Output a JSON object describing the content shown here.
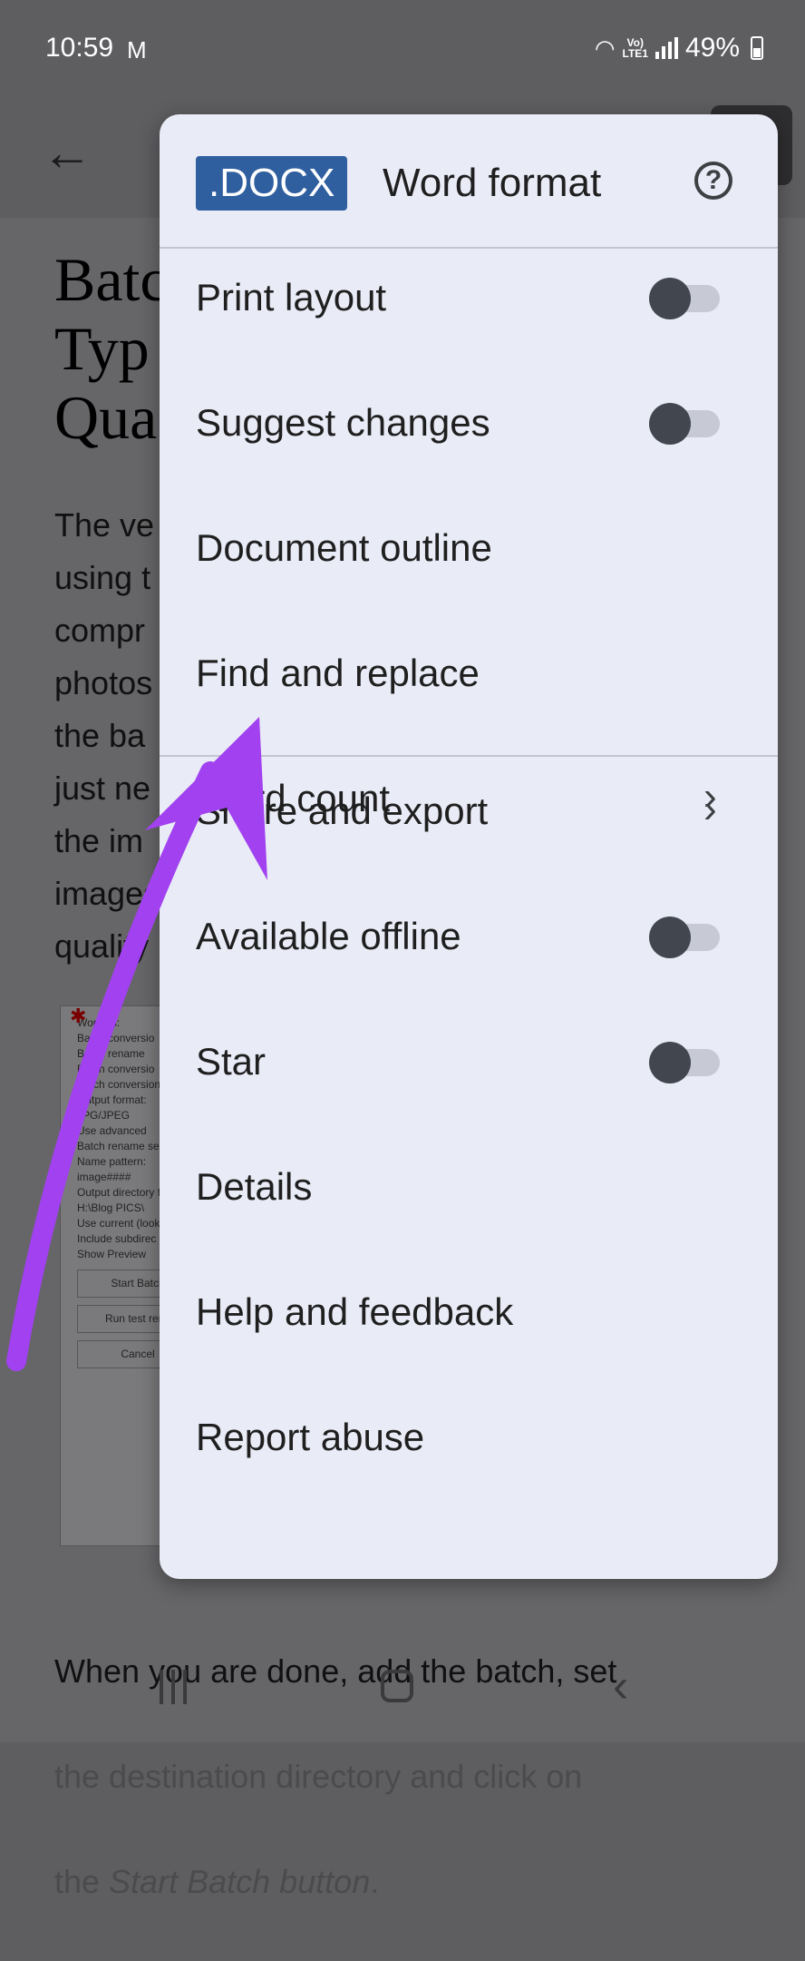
{
  "status_bar": {
    "time": "10:59",
    "mail_icon": "M",
    "volte_line1": "Vo)",
    "volte_line2": "LTE1",
    "battery": "49%"
  },
  "document": {
    "heading": "Batc\nTyp\nQua",
    "paragraph": "The ve\nusing t\ncompr\nphotos\nthe ba\njust ne\nthe im\nimages\nquality",
    "figure_lines": [
      "Work as:",
      "Batch conversio",
      "Batch rename",
      "Batch conversio",
      "Batch conversion s",
      "Output format:",
      "JPG/JPEG",
      "Use advanced",
      "Batch rename setti",
      "Name pattern:",
      "image####",
      "Output directory for",
      "H:\\Blog PICS\\",
      "Use current (look",
      "Include subdirec",
      "Show Preview"
    ],
    "figure_buttons": [
      "Start Batch",
      "Run test rena",
      "Cancel"
    ],
    "bottom_line1": "When you are done, add the batch, set",
    "bottom_line2": "the destination directory and click on",
    "bottom_line3_prefix": "the ",
    "bottom_line3_italic": "Start Batch button",
    "bottom_line3_suffix": "."
  },
  "menu": {
    "badge": ".DOCX",
    "title": "Word format",
    "help_icon": "?",
    "items": [
      {
        "label": "Print layout",
        "control": "toggle",
        "on": false
      },
      {
        "label": "Suggest changes",
        "control": "toggle",
        "on": false
      },
      {
        "label": "Document outline",
        "control": "none"
      },
      {
        "label": "Find and replace",
        "control": "none"
      },
      {
        "label": "Word count",
        "control": "chevron"
      },
      {
        "label": "Share and export",
        "control": "chevron"
      },
      {
        "label": "Available offline",
        "control": "toggle",
        "on": false
      },
      {
        "label": "Star",
        "control": "toggle",
        "on": false
      },
      {
        "label": "Details",
        "control": "none"
      },
      {
        "label": "Help and feedback",
        "control": "none"
      },
      {
        "label": "Report abuse",
        "control": "none"
      }
    ]
  },
  "annotation": {
    "color": "#a141f0",
    "target": "Find and replace"
  },
  "icons": {
    "back": "arrow-left",
    "help": "question-circle",
    "chevron": "chevron-right"
  }
}
